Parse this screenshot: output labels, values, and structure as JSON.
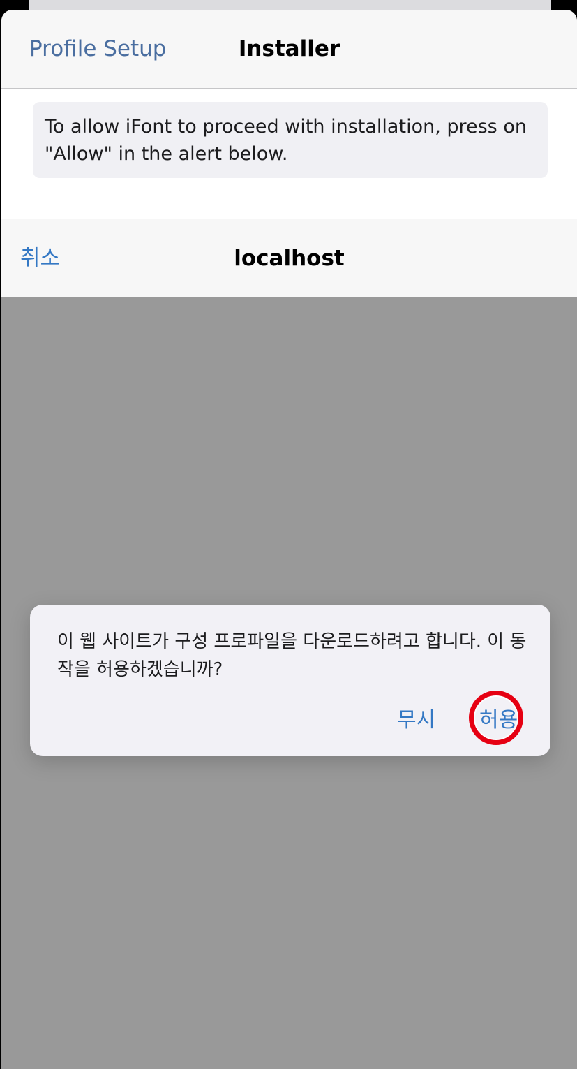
{
  "installer_nav": {
    "back_label": "Profile Setup",
    "title": "Installer"
  },
  "info_box": {
    "text": "To allow iFont to proceed with installation, press on \"Allow\" in the alert below."
  },
  "web_nav": {
    "cancel_label": "취소",
    "title": "localhost"
  },
  "alert": {
    "message": "이 웹 사이트가 구성 프로파일을 다운로드하려고 합니다. 이 동작을 허용하겠습니까?",
    "ignore_label": "무시",
    "allow_label": "허용"
  },
  "colors": {
    "accent": "#3478c4",
    "tap_indicator": "#e60012",
    "overlay": "#999999"
  }
}
